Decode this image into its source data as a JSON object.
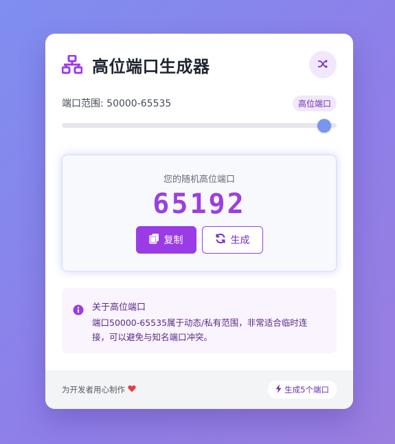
{
  "header": {
    "title": "高位端口生成器",
    "logo_icon": "network-icon",
    "shuffle_icon": "shuffle-icon"
  },
  "range": {
    "label": "端口范围: 50000-65535",
    "badge": "高位端口",
    "min": 50000,
    "max": 65535,
    "value": 65192
  },
  "result": {
    "caption": "您的随机高位端口",
    "port": "65192",
    "copy_label": "复制",
    "copy_icon": "copy-icon",
    "generate_label": "生成",
    "generate_icon": "refresh-icon"
  },
  "info": {
    "icon": "info-icon",
    "title": "关于高位端口",
    "text": "端口50000-65535属于动态/私有范围，非常适合临时连接，可以避免与知名端口冲突。"
  },
  "footer": {
    "credit": "为开发者用心制作",
    "heart_icon": "heart-icon",
    "batch_label": "生成5个端口",
    "batch_icon": "bolt-icon"
  },
  "colors": {
    "accent": "#9b3be6",
    "slider_thumb": "#7896f0",
    "heart": "#e53e3e"
  }
}
